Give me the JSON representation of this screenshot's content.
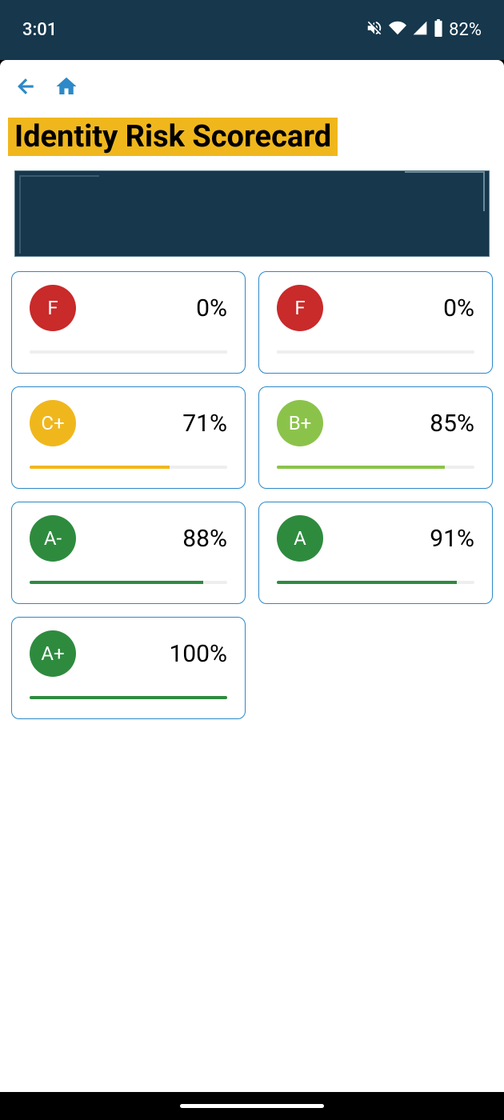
{
  "status_bar": {
    "time": "3:01",
    "battery": "82%"
  },
  "page": {
    "title": "Identity Risk Scorecard"
  },
  "scores": [
    {
      "grade": "F",
      "percent": "0%",
      "badge_class": "grade-f",
      "fill_class": "fill-f"
    },
    {
      "grade": "F",
      "percent": "0%",
      "badge_class": "grade-f",
      "fill_class": "fill-f"
    },
    {
      "grade": "C+",
      "percent": "71%",
      "badge_class": "grade-c",
      "fill_class": "fill-c"
    },
    {
      "grade": "B+",
      "percent": "85%",
      "badge_class": "grade-b",
      "fill_class": "fill-b"
    },
    {
      "grade": "A-",
      "percent": "88%",
      "badge_class": "grade-a-minus",
      "fill_class": "fill-a-minus"
    },
    {
      "grade": "A",
      "percent": "91%",
      "badge_class": "grade-a",
      "fill_class": "fill-a"
    },
    {
      "grade": "A+",
      "percent": "100%",
      "badge_class": "grade-a-plus",
      "fill_class": "fill-a-plus"
    }
  ]
}
